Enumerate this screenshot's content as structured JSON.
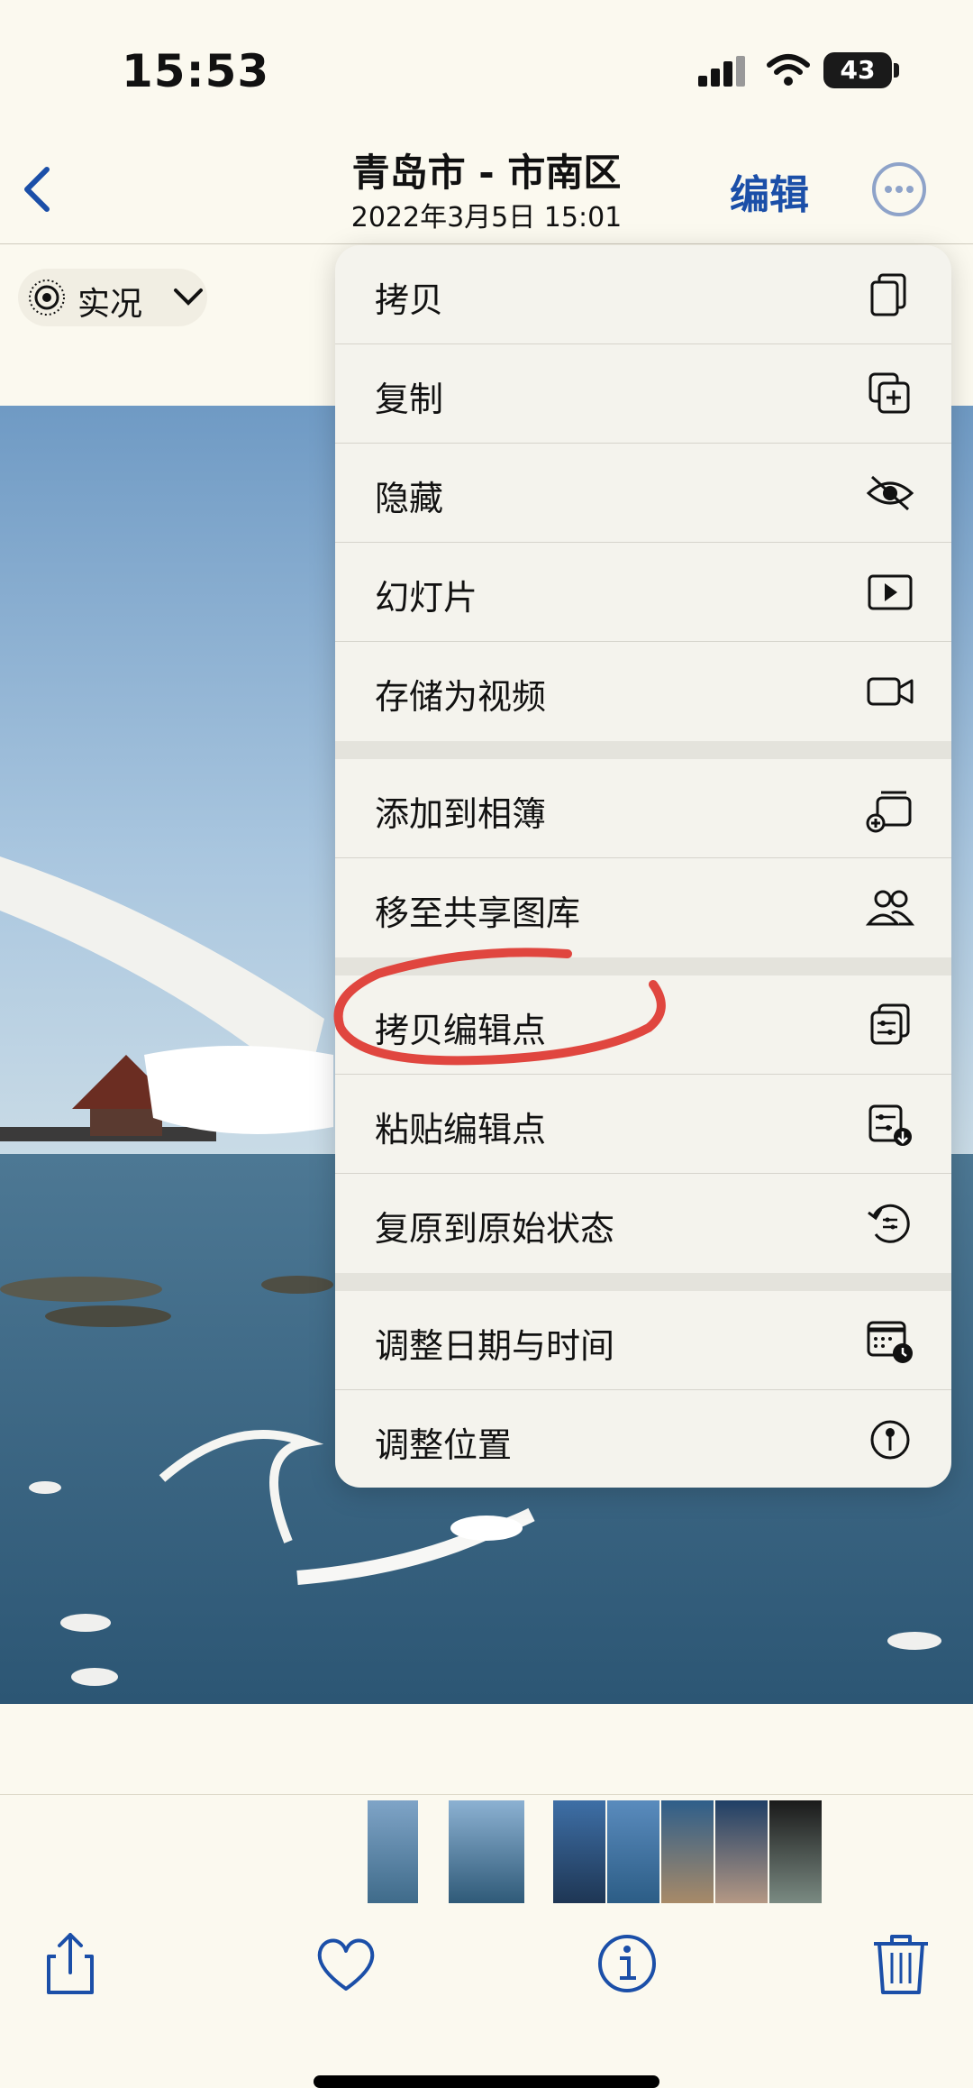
{
  "status": {
    "time": "15:53",
    "battery": "43"
  },
  "nav": {
    "title": "青岛市 - 市南区",
    "subtitle": "2022年3月5日  15:01",
    "edit_label": "编辑"
  },
  "live": {
    "label": "实况"
  },
  "menu": {
    "items": [
      {
        "label": "拷贝",
        "icon": "doc-copy-icon"
      },
      {
        "label": "复制",
        "icon": "duplicate-icon"
      },
      {
        "label": "隐藏",
        "icon": "eye-slash-icon"
      },
      {
        "label": "幻灯片",
        "icon": "play-rectangle-icon"
      },
      {
        "label": "存储为视频",
        "icon": "video-icon"
      },
      {
        "label": "添加到相簿",
        "icon": "add-to-album-icon"
      },
      {
        "label": "移至共享图库",
        "icon": "people-icon"
      },
      {
        "label": "拷贝编辑点",
        "icon": "copy-edits-icon"
      },
      {
        "label": "粘贴编辑点",
        "icon": "paste-edits-icon"
      },
      {
        "label": "复原到原始状态",
        "icon": "revert-icon"
      },
      {
        "label": "调整日期与时间",
        "icon": "calendar-clock-icon"
      },
      {
        "label": "调整位置",
        "icon": "location-icon"
      }
    ]
  },
  "toolbar": {
    "icons": [
      "share-icon",
      "heart-icon",
      "info-icon",
      "trash-icon"
    ]
  },
  "colors": {
    "accent": "#1b4fa8",
    "annotation": "#e0463f",
    "menu_bg": "#f4f3ed"
  }
}
